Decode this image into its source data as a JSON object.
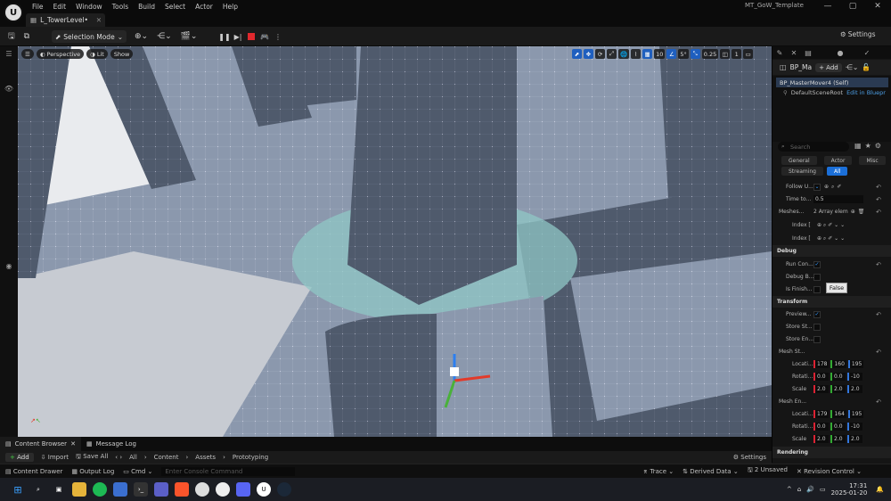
{
  "menu": [
    "File",
    "Edit",
    "Window",
    "Tools",
    "Build",
    "Select",
    "Actor",
    "Help"
  ],
  "project_name": "MT_GoW_Template",
  "window_controls": [
    "—",
    "▢",
    "✕"
  ],
  "level_tab": "L_TowerLevel•",
  "toolbar": {
    "selection_mode": "Selection Mode",
    "settings": "Settings"
  },
  "viewport": {
    "perspective": "Perspective",
    "lit": "Lit",
    "show": "Show",
    "grid_snap": "10",
    "rot_snap": "5°",
    "scale_snap": "0.25",
    "cam_speed": "1",
    "last": "1.8"
  },
  "details": {
    "title": "BP_Ma",
    "add": "Add",
    "selected_component": "BP_MasterMover4 (Self)",
    "root_component": "DefaultSceneRoot",
    "edit_link": "Edit in Bluepr",
    "search_placeholder": "Search",
    "categories": [
      "General",
      "Actor",
      "Misc",
      "Streaming",
      "All"
    ],
    "props": {
      "follow": "Follow U...",
      "time_to": "Time to...",
      "time_val": "0.5",
      "meshes": "Meshes...",
      "meshes_val": "2 Array elem",
      "index1": "Index [",
      "index2": "Index [",
      "debug_section": "Debug",
      "run_con": "Run Con...",
      "debug_b": "Debug B...",
      "is_finish": "Is Finish...",
      "transform_section": "Transform",
      "preview": "Preview...",
      "store_st": "Store St...",
      "store_en": "Store En...",
      "mesh_st": "Mesh St...",
      "mesh_en": "Mesh En...",
      "location": "Locati...",
      "rotation": "Rotati...",
      "scale": "Scale",
      "rendering_section": "Rendering",
      "start_loc": [
        "178",
        "160",
        "195"
      ],
      "start_rot": [
        "0.0",
        "0.0",
        "-10"
      ],
      "start_scale": [
        "2.0",
        "2.0",
        "2.0"
      ],
      "end_loc": [
        "179",
        "164",
        "195"
      ],
      "end_rot": [
        "0.0",
        "0.0",
        "-10"
      ],
      "end_scale": [
        "2.0",
        "2.0",
        "2.0"
      ]
    },
    "tooltip": "False"
  },
  "content_browser": {
    "tab1": "Content Browser",
    "tab2": "Message Log",
    "add": "Add",
    "import": "Import",
    "save_all": "Save All",
    "path": [
      "All",
      "Content",
      "Assets",
      "Prototyping"
    ],
    "settings": "Settings"
  },
  "status": {
    "content_drawer": "Content Drawer",
    "output_log": "Output Log",
    "cmd": "Cmd",
    "console_placeholder": "Enter Console Command",
    "trace": "Trace",
    "derived_data": "Derived Data",
    "unsaved": "2 Unsaved",
    "revision": "Revision Control"
  },
  "taskbar": {
    "time": "17:31",
    "date": "2025-01-20"
  }
}
